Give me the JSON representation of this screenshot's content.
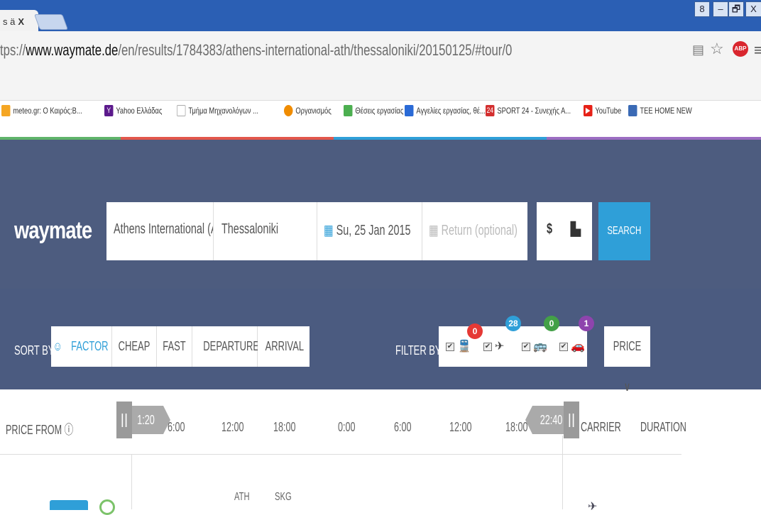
{
  "browser": {
    "tab_title": "s ä",
    "tab_close": "X",
    "window_controls": [
      "8",
      "–",
      "🗗",
      "X"
    ],
    "url_prefix": "tps://",
    "url_domain": "www.waymate.de",
    "url_path": "/en/results/1784383/athens-international-ath/thessaloniki/20150125/#tour/0",
    "bookmarks": [
      {
        "icon": "meteo-icon",
        "label": "meteo.gr: Ο Καιρός:Β...",
        "color": "#f5a623"
      },
      {
        "icon": "yahoo-icon",
        "label": "Yahoo Ελλάδας",
        "color": "#5c1a8c"
      },
      {
        "icon": "page-icon",
        "label": "Τμήμα Μηχανολόγων ...",
        "color": "#dddddd"
      },
      {
        "icon": "oaed-icon",
        "label": "Οργανισμός",
        "color": "#f08c00"
      },
      {
        "icon": "jobs-icon",
        "label": "Θέσεις εργασίας",
        "color": "#4caf50"
      },
      {
        "icon": "ads-icon",
        "label": "Αγγελίες εργασίας, θέ...",
        "color": "#2a6ad6"
      },
      {
        "icon": "sport24-icon",
        "label": "SPORT 24 - Συνεχής Α...",
        "color": "#d32f2f"
      },
      {
        "icon": "youtube-icon",
        "label": "YouTube",
        "color": "#e62117"
      },
      {
        "icon": "tee-icon",
        "label": "TEE HOME NEW",
        "color": "#3a6ab5"
      }
    ],
    "bookmark_icon_glyphs": {
      "sport24": "24"
    }
  },
  "search": {
    "logo": "waymate",
    "from": "Athens International (A",
    "to": "Thessaloniki",
    "date": "Su, 25 Jan 2015",
    "return_placeholder": "Return (optional)",
    "currency": "$",
    "search_label": "SEARCH"
  },
  "sort": {
    "label": "SORT BY",
    "options": [
      "FACTOR",
      "CHEAP",
      "FAST",
      "DEPARTURE",
      "ARRIVAL"
    ],
    "active": "FACTOR"
  },
  "filter": {
    "label": "FILTER BY",
    "items": [
      {
        "icon": "train-icon",
        "glyph": "🚆",
        "count": "0",
        "badge_color": "#e53935",
        "checked": "✔"
      },
      {
        "icon": "plane-icon",
        "glyph": "✈",
        "count": "28",
        "badge_color": "#2f9fd8",
        "checked": "✔"
      },
      {
        "icon": "bus-icon",
        "glyph": "🚌",
        "count": "0",
        "badge_color": "#43a047",
        "checked": "✔"
      },
      {
        "icon": "car-icon",
        "glyph": "🚗",
        "count": "1",
        "badge_color": "#8e44ad",
        "checked": "✔"
      }
    ],
    "price_label": "PRICE ∨"
  },
  "columns": {
    "price_from": "PRICE FROM ⓘ",
    "handle": "||",
    "start_time": "1:20",
    "end_time": "22:40",
    "ticks": [
      "6:00",
      "12:00",
      "18:00",
      "0:00",
      "6:00",
      "12:00",
      "18:00"
    ],
    "carrier": "CARRIER",
    "duration": "DURATION"
  },
  "result": {
    "from_code": "ATH",
    "to_code": "SKG"
  }
}
